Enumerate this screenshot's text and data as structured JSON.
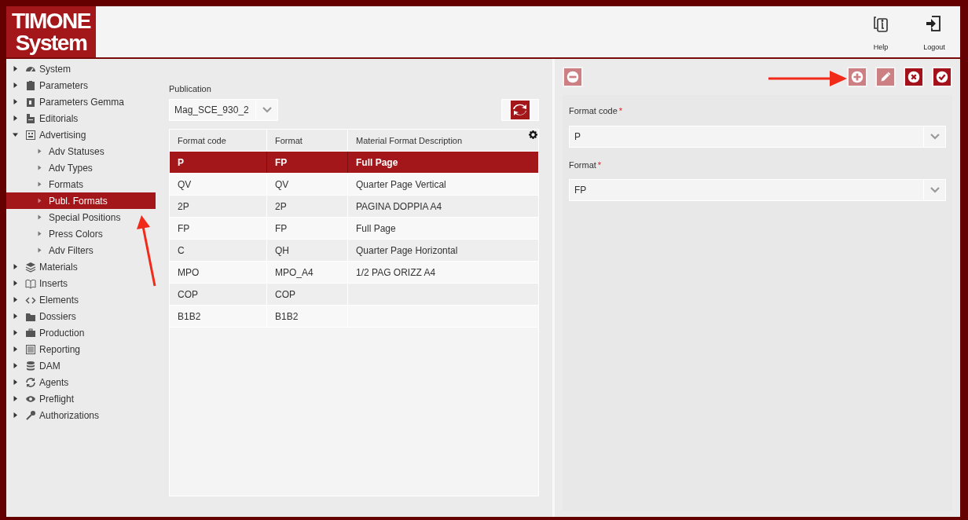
{
  "logo": {
    "line1": "TIMONE",
    "line2": "System"
  },
  "header_actions": [
    {
      "label": "Help"
    },
    {
      "label": "Logout"
    }
  ],
  "sidebar": {
    "items": [
      {
        "label": "System",
        "expanded": false,
        "selected": false
      },
      {
        "label": "Parameters",
        "expanded": false,
        "selected": false
      },
      {
        "label": "Parameters Gemma",
        "expanded": false,
        "selected": false
      },
      {
        "label": "Editorials",
        "expanded": false,
        "selected": false
      },
      {
        "label": "Advertising",
        "expanded": true,
        "selected": false,
        "children": [
          {
            "label": "Adv Statuses",
            "selected": false
          },
          {
            "label": "Adv Types",
            "selected": false
          },
          {
            "label": "Formats",
            "selected": false
          },
          {
            "label": "Publ. Formats",
            "selected": true
          },
          {
            "label": "Special Positions",
            "selected": false
          },
          {
            "label": "Press Colors",
            "selected": false
          },
          {
            "label": "Adv Filters",
            "selected": false
          }
        ]
      },
      {
        "label": "Materials",
        "expanded": false,
        "selected": false
      },
      {
        "label": "Inserts",
        "expanded": false,
        "selected": false
      },
      {
        "label": "Elements",
        "expanded": false,
        "selected": false
      },
      {
        "label": "Dossiers",
        "expanded": false,
        "selected": false
      },
      {
        "label": "Production",
        "expanded": false,
        "selected": false
      },
      {
        "label": "Reporting",
        "expanded": false,
        "selected": false
      },
      {
        "label": "DAM",
        "expanded": false,
        "selected": false
      },
      {
        "label": "Agents",
        "expanded": false,
        "selected": false
      },
      {
        "label": "Preflight",
        "expanded": false,
        "selected": false
      },
      {
        "label": "Authorizations",
        "expanded": false,
        "selected": false
      }
    ]
  },
  "publication": {
    "label": "Publication",
    "value": "Mag_SCE_930_2"
  },
  "table": {
    "columns": [
      "Format code",
      "Format",
      "Material Format Description"
    ],
    "rows": [
      {
        "cells": [
          "P",
          "FP",
          "Full Page"
        ],
        "selected": true
      },
      {
        "cells": [
          "QV",
          "QV",
          "Quarter Page Vertical"
        ],
        "selected": false
      },
      {
        "cells": [
          "2P",
          "2P",
          "PAGINA DOPPIA A4"
        ],
        "selected": false
      },
      {
        "cells": [
          "FP",
          "FP",
          "Full Page"
        ],
        "selected": false
      },
      {
        "cells": [
          "C",
          "QH",
          "Quarter Page Horizontal"
        ],
        "selected": false
      },
      {
        "cells": [
          "MPO",
          "MPO_A4",
          "1/2 PAG ORIZZ A4"
        ],
        "selected": false
      },
      {
        "cells": [
          "COP",
          "COP"
        ],
        "selected": false
      },
      {
        "cells": [
          "B1B2",
          "B1B2"
        ],
        "selected": false
      }
    ]
  },
  "toolbar": [
    {
      "kind": "remove",
      "disabled": true
    },
    {
      "kind": "add",
      "disabled": true
    },
    {
      "kind": "edit",
      "disabled": true
    },
    {
      "kind": "cancel",
      "disabled": false
    },
    {
      "kind": "confirm",
      "disabled": false
    }
  ],
  "form": {
    "fields": [
      {
        "label": "Format code",
        "required_mark": "*",
        "value": "P"
      },
      {
        "label": "Format",
        "required_mark": "*",
        "value": "FP"
      }
    ]
  }
}
